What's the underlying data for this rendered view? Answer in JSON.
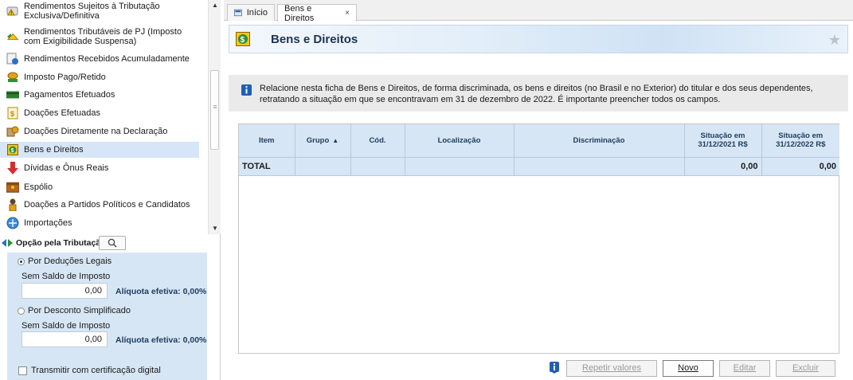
{
  "nav": {
    "items": [
      {
        "label": "Rendimentos Sujeitos à Tributação Exclusiva/Definitiva",
        "icon": "warning-coins-icon"
      },
      {
        "label": "Rendimentos Tributáveis de PJ (Imposto com Exigibilidade Suspensa)",
        "icon": "suspended-income-icon"
      },
      {
        "label": "Rendimentos Recebidos Acumuladamente",
        "icon": "accumulated-income-icon"
      },
      {
        "label": "Imposto Pago/Retido",
        "icon": "tax-paid-icon"
      },
      {
        "label": "Pagamentos Efetuados",
        "icon": "payments-icon"
      },
      {
        "label": "Doações Efetuadas",
        "icon": "donations-icon"
      },
      {
        "label": "Doações Diretamente na Declaração",
        "icon": "direct-donations-icon"
      },
      {
        "label": "Bens e Direitos",
        "icon": "assets-icon"
      },
      {
        "label": "Dívidas e Ônus Reais",
        "icon": "debts-icon"
      },
      {
        "label": "Espólio",
        "icon": "estate-icon"
      },
      {
        "label": "Doações a Partidos Políticos e Candidatos",
        "icon": "political-donations-icon"
      },
      {
        "label": "Importações",
        "icon": "imports-icon"
      }
    ],
    "selected": "Bens e Direitos"
  },
  "opcao": {
    "title": "Opção pela Tributação:",
    "deducoes_label": "Por Deduções Legais",
    "deducoes_saldo_label": "Sem Saldo de Imposto",
    "deducoes_value": "0,00",
    "deducoes_aliquota": "Alíquota efetiva: 0,00%",
    "simplificado_label": "Por Desconto Simplificado",
    "simplificado_saldo_label": "Sem Saldo de Imposto",
    "simplificado_value": "0,00",
    "simplificado_aliquota": "Alíquota efetiva: 0,00%",
    "certificacao_label": "Transmitir com certificação digital",
    "selected": "Por Deduções Legais"
  },
  "tabs": [
    {
      "label": "Início",
      "active": false
    },
    {
      "label": "Bens e Direitos",
      "close": "×",
      "active": true
    }
  ],
  "page": {
    "title": "Bens e Direitos",
    "info": "Relacione nesta ficha de Bens e Direitos, de forma discriminada, os bens e direitos (no Brasil e no Exterior) do titular e dos seus dependentes, retratando a situação em que se encontravam em 31 de dezembro de 2022. É importante preencher todos os campos."
  },
  "table": {
    "columns": [
      {
        "label": "Item"
      },
      {
        "label": "Grupo",
        "sort": "▲"
      },
      {
        "label": "Cód."
      },
      {
        "label": "Localização"
      },
      {
        "label": "Discriminação"
      },
      {
        "label": "Situação em 31/12/2021 R$"
      },
      {
        "label": "Situação em 31/12/2022 R$"
      }
    ],
    "total_row": {
      "label": "TOTAL",
      "sit2021": "0,00",
      "sit2022": "0,00"
    }
  },
  "toolbar": {
    "repetir": "Repetir valores",
    "novo": "Novo",
    "editar": "Editar",
    "excluir": "Excluir"
  },
  "colors": {
    "selected_bg": "#d6e6f8",
    "panel_bg": "#d7e6f5",
    "title_color": "#1c3353"
  }
}
